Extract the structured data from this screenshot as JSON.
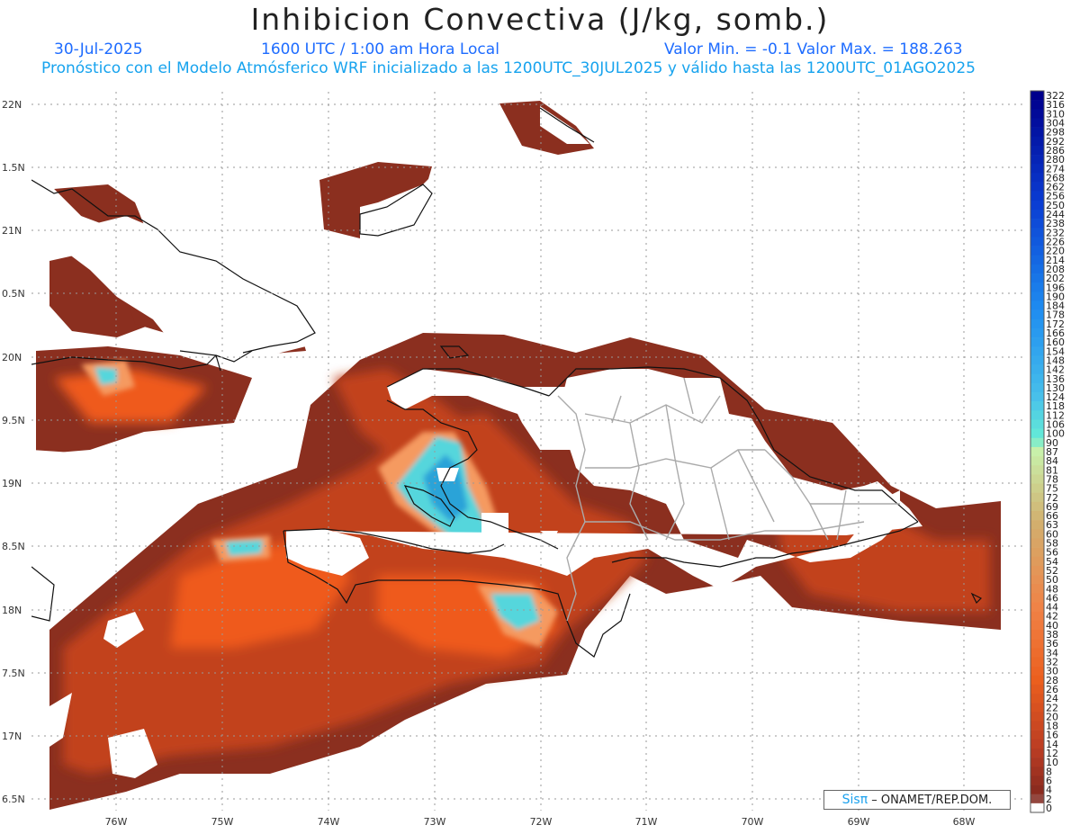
{
  "title": "Inhibicion Convectiva (J/kg, somb.)",
  "header": {
    "date": "30-Jul-2025",
    "time": "1600 UTC / 1:00 am Hora Local",
    "minmax": "Valor Min. = -0.1  Valor Max. = 188.263",
    "forecast": "Pronóstico con el Modelo Atmósferico WRF inicializado a las 1200UTC_30JUL2025 y válido hasta las  1200UTC_01AGO2025"
  },
  "map": {
    "lat_labels": [
      "22N",
      "1.5N",
      "21N",
      "0.5N",
      "20N",
      "9.5N",
      "19N",
      "8.5N",
      "18N",
      "7.5N",
      "17N",
      "6.5N"
    ],
    "lon_labels": [
      "76W",
      "75W",
      "74W",
      "73W",
      "72W",
      "71W",
      "70W",
      "69W",
      "68W"
    ],
    "colors": {
      "dark": "#8b2f1f",
      "mid": "#c2421f",
      "orange": "#ef5a1c",
      "light": "#f59a60",
      "cyan": "#55d6dc",
      "blue": "#2aa3d8",
      "border": "#111111",
      "province": "#aaaaaa",
      "grid": "#999999"
    }
  },
  "colorbar": {
    "labels": [
      "322",
      "316",
      "310",
      "304",
      "298",
      "292",
      "286",
      "280",
      "274",
      "268",
      "262",
      "256",
      "250",
      "244",
      "238",
      "232",
      "226",
      "220",
      "214",
      "208",
      "202",
      "196",
      "190",
      "184",
      "178",
      "172",
      "166",
      "160",
      "154",
      "148",
      "142",
      "136",
      "130",
      "124",
      "118",
      "112",
      "106",
      "100",
      "90",
      "87",
      "84",
      "81",
      "78",
      "75",
      "72",
      "69",
      "66",
      "63",
      "60",
      "58",
      "56",
      "54",
      "52",
      "50",
      "48",
      "46",
      "44",
      "42",
      "40",
      "38",
      "36",
      "34",
      "32",
      "30",
      "28",
      "26",
      "24",
      "22",
      "20",
      "18",
      "16",
      "14",
      "12",
      "10",
      "8",
      "6",
      "4",
      "2",
      "0"
    ]
  },
  "credit": {
    "sis": "Sisπ",
    "rest": "– ONAMET/REP.DOM."
  }
}
